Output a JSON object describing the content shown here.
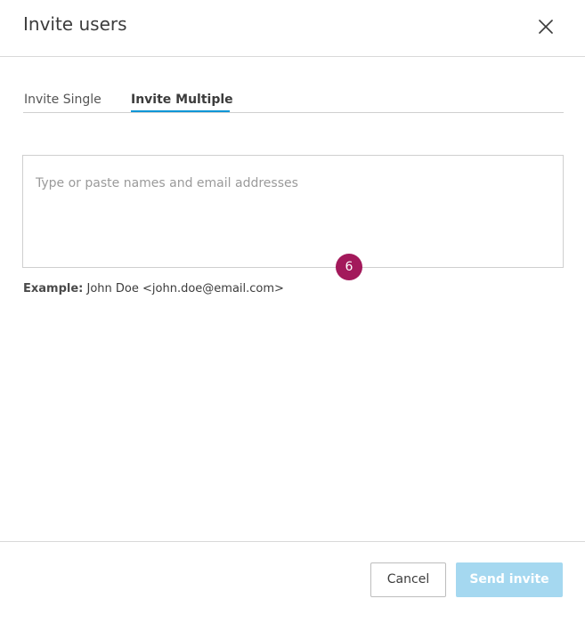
{
  "dialog": {
    "title": "Invite users",
    "close_icon": "close-icon"
  },
  "tabs": [
    {
      "label": "Invite Single",
      "active": false
    },
    {
      "label": "Invite Multiple",
      "active": true
    }
  ],
  "invite_input": {
    "value": "",
    "placeholder": "Type or paste names and email addresses"
  },
  "step_badge": "6",
  "example": {
    "label": "Example:",
    "value": "John Doe <john.doe@email.com>"
  },
  "footer": {
    "cancel_label": "Cancel",
    "send_label": "Send invite"
  },
  "colors": {
    "accent": "#0696d7",
    "send_disabled": "#a5d8f0",
    "badge": "#a3195b"
  }
}
